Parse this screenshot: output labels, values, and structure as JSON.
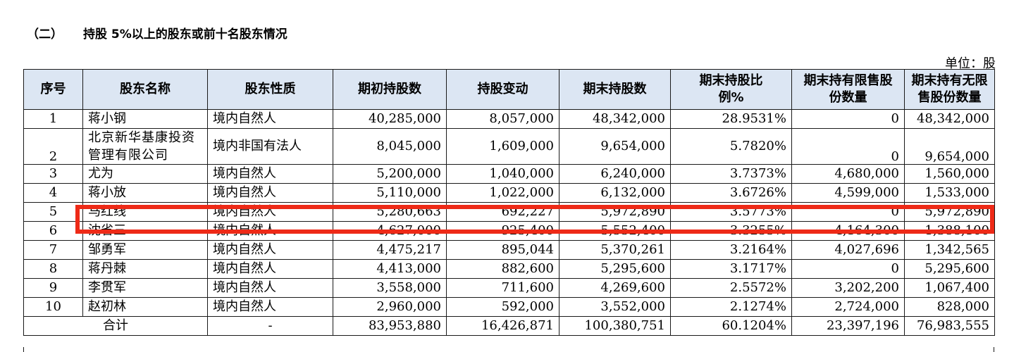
{
  "section": {
    "number": "（二）",
    "title": "持股 5%以上的股东或前十名股东情况"
  },
  "unit": "单位：股",
  "table": {
    "headers": [
      "序号",
      "股东名称",
      "股东性质",
      "期初持股数",
      "持股变动",
      "期末持股数",
      "期末持股比例%",
      "期末持有限售股份数量",
      "期末持有无限售股份数量"
    ],
    "rows": [
      [
        "1",
        "蒋小钢",
        "境内自然人",
        "40,285,000",
        "8,057,000",
        "48,342,000",
        "28.9531%",
        "0",
        "48,342,000"
      ],
      [
        "2",
        "北京新华基康投资管理有限公司",
        "境内非国有法人",
        "8,045,000",
        "1,609,000",
        "9,654,000",
        "5.7820%",
        "0",
        "9,654,000"
      ],
      [
        "3",
        "尤为",
        "境内自然人",
        "5,200,000",
        "1,040,000",
        "6,240,000",
        "3.7373%",
        "4,680,000",
        "1,560,000"
      ],
      [
        "4",
        "蒋小放",
        "境内自然人",
        "5,110,000",
        "1,022,000",
        "6,132,000",
        "3.6726%",
        "4,599,000",
        "1,533,000"
      ],
      [
        "5",
        "马红线",
        "境内自然人",
        "5,280,663",
        "692,227",
        "5,972,890",
        "3.5773%",
        "0",
        "5,972,890"
      ],
      [
        "6",
        "沈省三",
        "境内自然人",
        "4,627,000",
        "925,400",
        "5,552,400",
        "3.3255%",
        "4,164,300",
        "1,388,100"
      ],
      [
        "7",
        "邹勇军",
        "境内自然人",
        "4,475,217",
        "895,044",
        "5,370,261",
        "3.2164%",
        "4,027,696",
        "1,342,565"
      ],
      [
        "8",
        "蒋丹棘",
        "境内自然人",
        "4,413,000",
        "882,600",
        "5,295,600",
        "3.1717%",
        "0",
        "5,295,600"
      ],
      [
        "9",
        "李贯军",
        "境内自然人",
        "3,558,000",
        "711,600",
        "4,269,600",
        "2.5572%",
        "3,202,200",
        "1,067,400"
      ],
      [
        "10",
        "赵初林",
        "境内自然人",
        "2,960,000",
        "592,000",
        "3,552,000",
        "2.1274%",
        "2,724,000",
        "828,000"
      ]
    ],
    "total": [
      "合计",
      "-",
      "83,953,880",
      "16,426,871",
      "100,380,751",
      "60.1204%",
      "23,397,196",
      "76,983,555"
    ]
  },
  "highlight_color": "#ee2a17",
  "header_bg": "#dce6f3"
}
